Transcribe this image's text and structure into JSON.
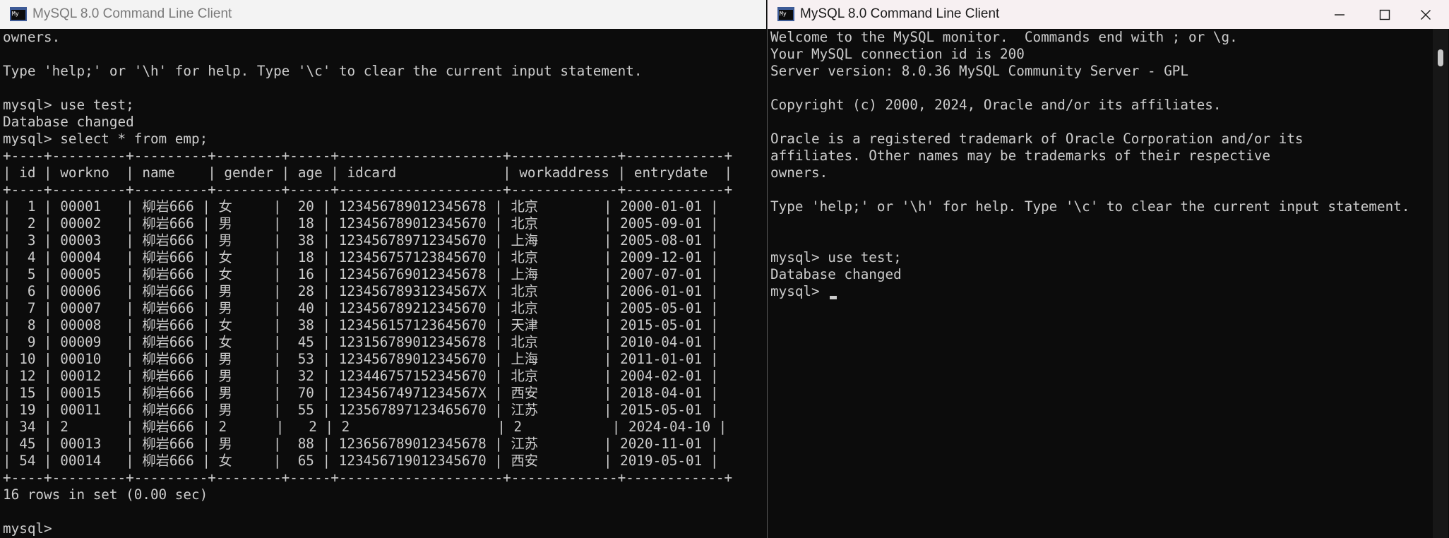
{
  "left_window": {
    "title": "MySQL 8.0 Command Line Client",
    "icon_text": "My",
    "lines": [
      "owners.",
      "",
      "Type 'help;' or '\\h' for help. Type '\\c' to clear the current input statement.",
      "",
      "mysql> use test;",
      "Database changed",
      "mysql> select * from emp;",
      "+----+---------+---------+--------+-----+--------------------+-------------+------------+",
      "| id | workno  | name    | gender | age | idcard             | workaddress | entrydate  |",
      "+----+---------+---------+--------+-----+--------------------+-------------+------------+",
      "|  1 | 00001   | 柳岩666 | 女     |  20 | 123456789012345678 | 北京        | 2000-01-01 |",
      "|  2 | 00002   | 柳岩666 | 男     |  18 | 123456789012345670 | 北京        | 2005-09-01 |",
      "|  3 | 00003   | 柳岩666 | 男     |  38 | 123456789712345670 | 上海        | 2005-08-01 |",
      "|  4 | 00004   | 柳岩666 | 女     |  18 | 123456757123845670 | 北京        | 2009-12-01 |",
      "|  5 | 00005   | 柳岩666 | 女     |  16 | 123456769012345678 | 上海        | 2007-07-01 |",
      "|  6 | 00006   | 柳岩666 | 男     |  28 | 12345678931234567X | 北京        | 2006-01-01 |",
      "|  7 | 00007   | 柳岩666 | 男     |  40 | 123456789212345670 | 北京        | 2005-05-01 |",
      "|  8 | 00008   | 柳岩666 | 女     |  38 | 123456157123645670 | 天津        | 2015-05-01 |",
      "|  9 | 00009   | 柳岩666 | 女     |  45 | 123156789012345678 | 北京        | 2010-04-01 |",
      "| 10 | 00010   | 柳岩666 | 男     |  53 | 123456789012345670 | 上海        | 2011-01-01 |",
      "| 12 | 00012   | 柳岩666 | 男     |  32 | 123446757152345670 | 北京        | 2004-02-01 |",
      "| 15 | 00015   | 柳岩666 | 男     |  70 | 12345674971234567X | 西安        | 2018-04-01 |",
      "| 19 | 00011   | 柳岩666 | 男     |  55 | 123567897123465670 | 江苏        | 2015-05-01 |",
      "| 34 | 2       | 柳岩666 | 2      |   2 | 2                  | 2           | 2024-04-10 |",
      "| 45 | 00013   | 柳岩666 | 男     |  88 | 123656789012345678 | 江苏        | 2020-11-01 |",
      "| 54 | 00014   | 柳岩666 | 女     |  65 | 123456719012345670 | 西安        | 2019-05-01 |",
      "+----+---------+---------+--------+-----+--------------------+-------------+------------+",
      "16 rows in set (0.00 sec)",
      "",
      "mysql>"
    ]
  },
  "right_window": {
    "title": "MySQL 8.0 Command Line Client",
    "icon_text": "My",
    "lines": [
      "Welcome to the MySQL monitor.  Commands end with ; or \\g.",
      "Your MySQL connection id is 200",
      "Server version: 8.0.36 MySQL Community Server - GPL",
      "",
      "Copyright (c) 2000, 2024, Oracle and/or its affiliates.",
      "",
      "Oracle is a registered trademark of Oracle Corporation and/or its",
      "affiliates. Other names may be trademarks of their respective",
      "owners.",
      "",
      "Type 'help;' or '\\h' for help. Type '\\c' to clear the current input statement.",
      "",
      "",
      "mysql> use test;",
      "Database changed",
      "mysql> "
    ]
  }
}
